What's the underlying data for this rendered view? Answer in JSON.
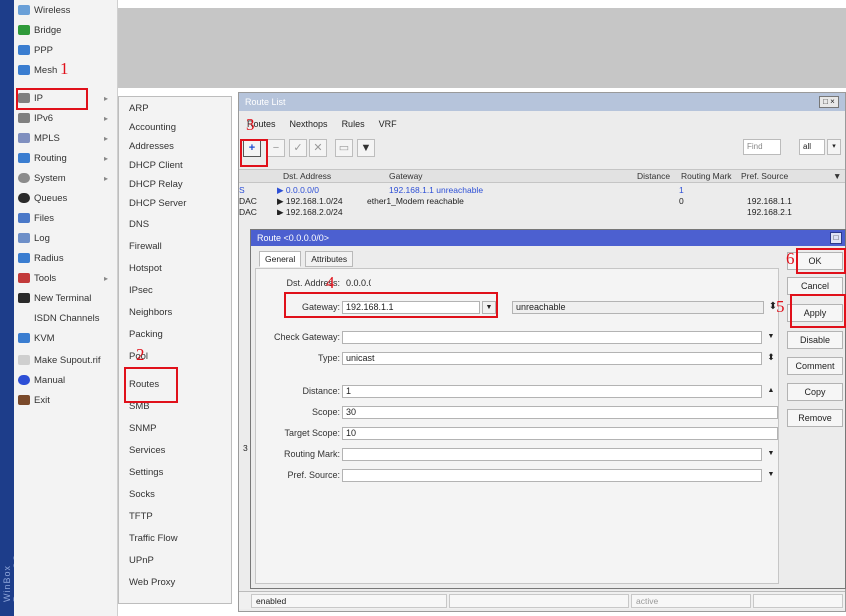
{
  "menu": {
    "items": [
      {
        "label": "Wireless",
        "icon": "wireless-icon",
        "color": "#6aa0d8"
      },
      {
        "label": "Bridge",
        "icon": "bridge-icon",
        "color": "#2f9a3a"
      },
      {
        "label": "PPP",
        "icon": "ppp-icon",
        "color": "#3a7dd0"
      },
      {
        "label": "Mesh",
        "icon": "mesh-icon",
        "color": "#3a7dd0"
      },
      {
        "label": "IP",
        "icon": "ip-icon",
        "color": "#808080"
      },
      {
        "label": "IPv6",
        "icon": "ipv6-icon",
        "color": "#808080"
      },
      {
        "label": "MPLS",
        "icon": "mpls-icon",
        "color": "#7f8fbf"
      },
      {
        "label": "Routing",
        "icon": "routing-icon",
        "color": "#3a7dd0"
      },
      {
        "label": "System",
        "icon": "gear-icon",
        "color": "#8b8b8b"
      },
      {
        "label": "Queues",
        "icon": "queues-icon",
        "color": "#2a2a2a"
      },
      {
        "label": "Files",
        "icon": "folder-icon",
        "color": "#4a78c8"
      },
      {
        "label": "Log",
        "icon": "log-icon",
        "color": "#6d8fc8"
      },
      {
        "label": "Radius",
        "icon": "radius-icon",
        "color": "#3a7dd0"
      },
      {
        "label": "Tools",
        "icon": "tools-icon",
        "color": "#c23a3a"
      },
      {
        "label": "New Terminal",
        "icon": "terminal-icon",
        "color": "#2a2a2a"
      },
      {
        "label": "ISDN Channels",
        "icon": "isdn-icon",
        "color": "#f3f3f3"
      },
      {
        "label": "KVM",
        "icon": "kvm-icon",
        "color": "#3a7dd0"
      },
      {
        "label": "Make Supout.rif",
        "icon": "document-icon",
        "color": "#cfcfcf"
      },
      {
        "label": "Manual",
        "icon": "help-icon",
        "color": "#2d4fd6"
      },
      {
        "label": "Exit",
        "icon": "exit-icon",
        "color": "#7a4a2a"
      }
    ],
    "arrow_glyph": "▸"
  },
  "brand": "WinBox RouterOS",
  "submenu": {
    "items": [
      "ARP",
      "Accounting",
      "Addresses",
      "DHCP Client",
      "DHCP Relay",
      "DHCP Server",
      "DNS",
      "Firewall",
      "Hotspot",
      "IPsec",
      "Neighbors",
      "Packing",
      "Pool",
      "Routes",
      "SMB",
      "SNMP",
      "Services",
      "Settings",
      "Socks",
      "TFTP",
      "Traffic Flow",
      "UPnP",
      "Web Proxy"
    ]
  },
  "route_list": {
    "title": "Route List",
    "close_label": "□ ×",
    "tabs": [
      "Routes",
      "Nexthops",
      "Rules",
      "VRF"
    ],
    "toolbar": {
      "add": "+",
      "remove": "−",
      "enable": "✓",
      "disable": "✕",
      "comment": "▭",
      "filter": "▼"
    },
    "find_placeholder": "Find",
    "filter_value": "all",
    "filter_arrow": "▾",
    "columns": [
      "Dst. Address",
      "Gateway",
      "Distance",
      "Routing Mark",
      "Pref. Source"
    ],
    "column_menu": "▼",
    "rows": [
      {
        "flags": "S",
        "dst": "▶ 0.0.0.0/0",
        "gateway": "192.168.1.1 unreachable",
        "distance": "1",
        "mark": "",
        "pref": ""
      },
      {
        "flags": "DAC",
        "dst": "▶ 192.168.1.0/24",
        "gateway": "ether1_Modem reachable",
        "distance": "0",
        "mark": "",
        "pref": "192.168.1.1"
      },
      {
        "flags": "DAC",
        "dst": "▶ 192.168.2.0/24",
        "gateway": "",
        "distance": "",
        "mark": "",
        "pref": "192.168.2.1"
      }
    ],
    "count": "3",
    "status": "enabled",
    "status_right": "active"
  },
  "route_dialog": {
    "title": "Route <0.0.0.0/0>",
    "close_label": "□",
    "tabs": [
      "General",
      "Attributes"
    ],
    "fields": {
      "dst_label": "Dst. Address:",
      "dst_value": "0.0.0.0/0",
      "gateway_label": "Gateway:",
      "gateway_value": "192.168.1.1",
      "gateway_state": "unreachable",
      "check_gateway_label": "Check Gateway:",
      "check_gateway_value": "",
      "type_label": "Type:",
      "type_value": "unicast",
      "distance_label": "Distance:",
      "distance_value": "1",
      "scope_label": "Scope:",
      "scope_value": "30",
      "target_scope_label": "Target Scope:",
      "target_scope_value": "10",
      "routing_mark_label": "Routing Mark:",
      "routing_mark_value": "",
      "pref_source_label": "Pref. Source:",
      "pref_source_value": ""
    },
    "glyphs": {
      "down": "▼",
      "up": "▲",
      "updown": "⬍",
      "updown_small": "⬍"
    },
    "buttons": {
      "ok": "OK",
      "cancel": "Cancel",
      "apply": "Apply",
      "disable": "Disable",
      "comment": "Comment",
      "copy": "Copy",
      "remove": "Remove"
    }
  },
  "annotations": {
    "steps": [
      "1",
      "2",
      "3",
      "4",
      "5",
      "6"
    ],
    "color": "#e0101a"
  }
}
